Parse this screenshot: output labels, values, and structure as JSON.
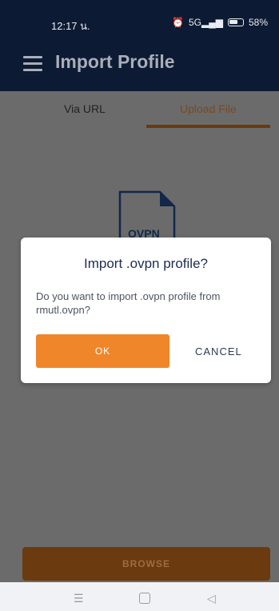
{
  "status_bar": {
    "time": "12:17 น.",
    "battery": "58%",
    "signal_text": "5G",
    "icons": [
      "alarm-icon",
      "vibrate-icon",
      "signal-icon",
      "battery-icon"
    ]
  },
  "app_bar": {
    "title": "Import Profile",
    "menu_icon": "hamburger-icon"
  },
  "tabs": [
    {
      "label": "Via URL",
      "selected": false
    },
    {
      "label": "Upload File",
      "selected": true
    }
  ],
  "file_placeholder": {
    "label": "OVPN"
  },
  "browse_button": {
    "label": "BROWSE"
  },
  "dialog": {
    "title": "Import .ovpn profile?",
    "message": "Do you want to import .ovpn profile from rmutl.ovpn?",
    "ok_label": "OK",
    "cancel_label": "CANCEL"
  },
  "nav_bar": {
    "menu_glyph": "☰",
    "back_glyph": "◁"
  },
  "colors": {
    "app_bar_bg": "#0d1a33",
    "accent_orange": "#f0862a",
    "tab_underline": "#6b3a0e"
  }
}
